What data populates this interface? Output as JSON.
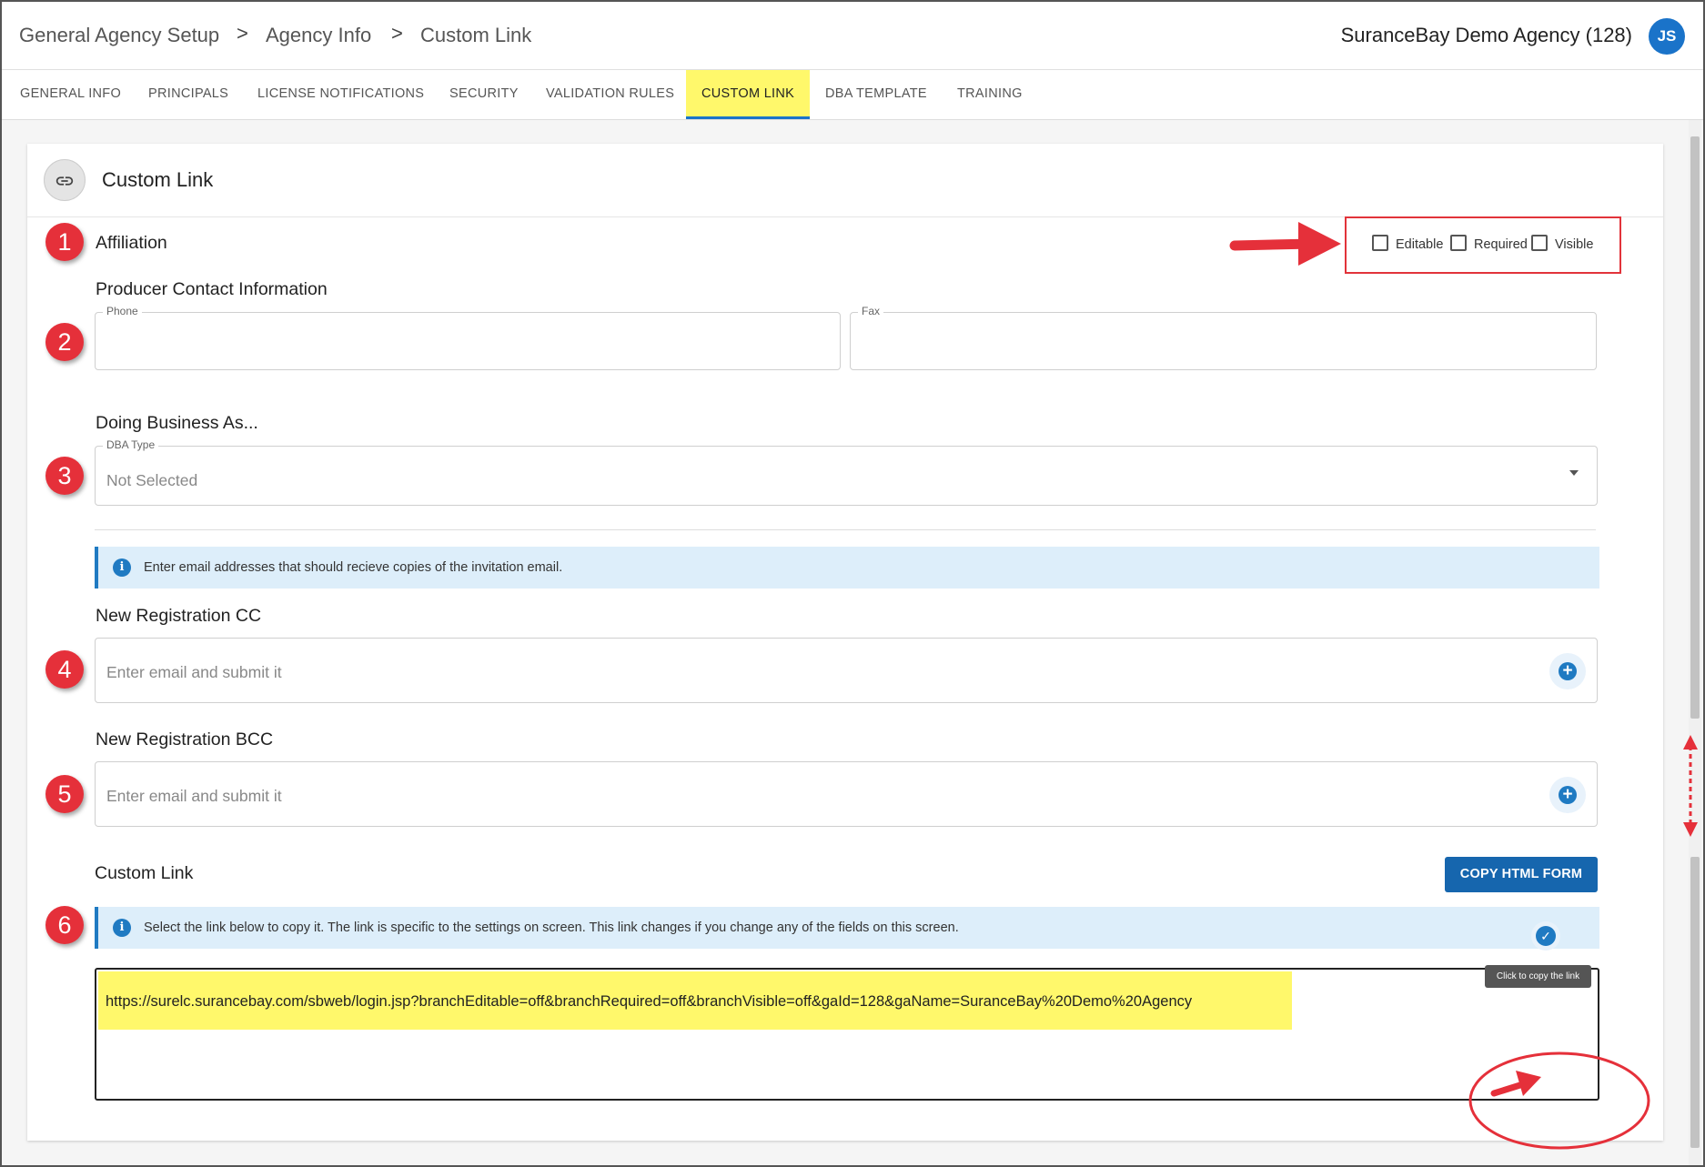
{
  "header": {
    "breadcrumbs": [
      "General Agency Setup",
      "Agency Info",
      "Custom Link"
    ],
    "separator": ">",
    "agency_name": "SuranceBay Demo Agency (128)",
    "avatar_initials": "JS"
  },
  "tabs": [
    {
      "label": "GENERAL INFO",
      "active": false
    },
    {
      "label": "PRINCIPALS",
      "active": false
    },
    {
      "label": "LICENSE NOTIFICATIONS",
      "active": false
    },
    {
      "label": "SECURITY",
      "active": false
    },
    {
      "label": "VALIDATION RULES",
      "active": false
    },
    {
      "label": "CUSTOM LINK",
      "active": true
    },
    {
      "label": "DBA TEMPLATE",
      "active": false
    },
    {
      "label": "TRAINING",
      "active": false
    }
  ],
  "card": {
    "title": "Custom Link",
    "icon": "link-icon"
  },
  "affiliation": {
    "label": "Affiliation",
    "options": [
      {
        "label": "Editable",
        "checked": false
      },
      {
        "label": "Required",
        "checked": false
      },
      {
        "label": "Visible",
        "checked": false
      }
    ]
  },
  "producer_contact": {
    "label": "Producer Contact Information",
    "phone_label": "Phone",
    "phone_value": "",
    "fax_label": "Fax",
    "fax_value": ""
  },
  "dba": {
    "label": "Doing Business As...",
    "type_label": "DBA Type",
    "type_value": "Not Selected"
  },
  "email_info": "Enter email addresses that should recieve copies of the invitation email.",
  "registration_cc": {
    "label": "New Registration CC",
    "placeholder": "Enter email and submit it"
  },
  "registration_bcc": {
    "label": "New Registration BCC",
    "placeholder": "Enter email and submit it"
  },
  "custom_link": {
    "label": "Custom Link",
    "copy_button": "COPY HTML FORM",
    "info": "Select the link below to copy it. The link is specific to the settings on screen. This link changes if you change any of the fields on this screen.",
    "url": "https://surelc.surancebay.com/sbweb/login.jsp?branchEditable=off&branchRequired=off&branchVisible=off&gaId=128&gaName=SuranceBay%20Demo%20Agency",
    "copy_tooltip": "Click to copy the link"
  },
  "annotations": [
    "1",
    "2",
    "3",
    "4",
    "5",
    "6"
  ],
  "colors": {
    "accent": "#1f7ac2",
    "button": "#1666ae",
    "highlight": "#fff86b",
    "annotation_red": "#e5303a",
    "info_bg": "#ddeefa"
  }
}
